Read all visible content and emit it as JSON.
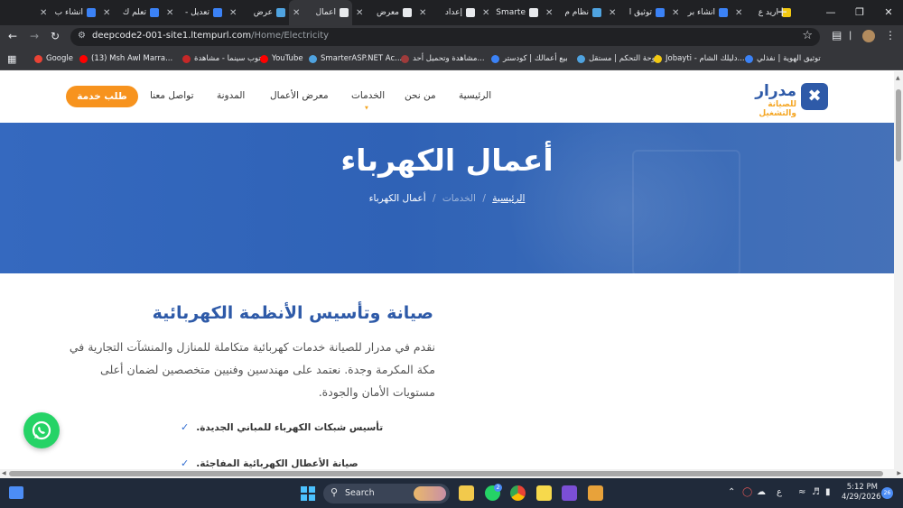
{
  "browser": {
    "tabs": [
      {
        "title": "اريد ع",
        "color": "#f2c811"
      },
      {
        "title": "انشاء بر",
        "color": "#3b82f6"
      },
      {
        "title": "توثيق ا",
        "color": "#3b82f6"
      },
      {
        "title": "نظام م",
        "color": "#4fa3e0"
      },
      {
        "title": "Smarte",
        "color": "#e8eaed"
      },
      {
        "title": "إعداد",
        "color": "#e8eaed"
      },
      {
        "title": "معرض",
        "color": "#e8eaed"
      },
      {
        "title": "أعمال",
        "color": "#e8eaed",
        "active": true
      },
      {
        "title": "عرض",
        "color": "#4fa3e0"
      },
      {
        "title": "تعديل -",
        "color": "#3b82f6"
      },
      {
        "title": "تعلم ك",
        "color": "#3b82f6"
      },
      {
        "title": "انشاء ب",
        "color": "#3b82f6"
      }
    ],
    "new_tab": "+",
    "url_host": "deepcode2-001-site1.ltempurl.com",
    "url_path": "/Home/Electricity",
    "bookmarks": [
      {
        "label": "Google",
        "color": "#ea4335"
      },
      {
        "label": "(13) Msh Awl Marra...",
        "color": "#ff0000"
      },
      {
        "label": "توب سينما - مشاهدة...",
        "color": "#c62828"
      },
      {
        "label": "YouTube",
        "color": "#ff0000"
      },
      {
        "label": "SmarterASP.NET Ac...",
        "color": "#4fa3e0"
      },
      {
        "label": "مشاهدة وتحميل أحد...",
        "color": "#9e3b3b"
      },
      {
        "label": "بيع أعمالك | كودستر",
        "color": "#3b82f6"
      },
      {
        "label": "لوحة التحكم | مستقل",
        "color": "#4fa3e0"
      },
      {
        "label": "Jobayti - دليلك الشام...",
        "color": "#f2c811"
      },
      {
        "label": "توثيق الهوية | نفذلي",
        "color": "#3b82f6"
      }
    ]
  },
  "site": {
    "logo_name": "مدرار",
    "logo_tagline": "للصيانة والتشغيل",
    "nav": {
      "home": "الرئيسية",
      "about": "من نحن",
      "services": "الخدمات",
      "portfolio": "معرض الأعمال",
      "blog": "المدونة",
      "contact": "تواصل معنا"
    },
    "cta": "طلب خدمة",
    "hero_title": "أعمال الكهرباء",
    "breadcrumb": {
      "home": "الرئيسية",
      "sep": "/",
      "services": "الخدمات",
      "current": "أعمال الكهرباء"
    },
    "section_title": "صيانة وتأسيس الأنظمة الكهربائية",
    "section_text": "نقدم في مدرار للصيانة خدمات كهربائية متكاملة للمنازل والمنشآت التجارية في مكة المكرمة وجدة. نعتمد على مهندسين وفنيين متخصصين لضمان أعلى مستويات الأمان والجودة.",
    "features": [
      "تأسيس شبكات الكهرباء للمباني الجديدة.",
      "صيانة الأعطال الكهربائية المفاجئة."
    ]
  },
  "taskbar": {
    "search_label": "Search",
    "whatsapp_badge": "2",
    "lang": "ع",
    "time": "5:12 PM",
    "date": "4/29/2026",
    "notifications": "26"
  },
  "colors": {
    "brand_blue": "#2e5aa8",
    "accent_orange": "#f7931e",
    "whatsapp_green": "#25d366"
  }
}
